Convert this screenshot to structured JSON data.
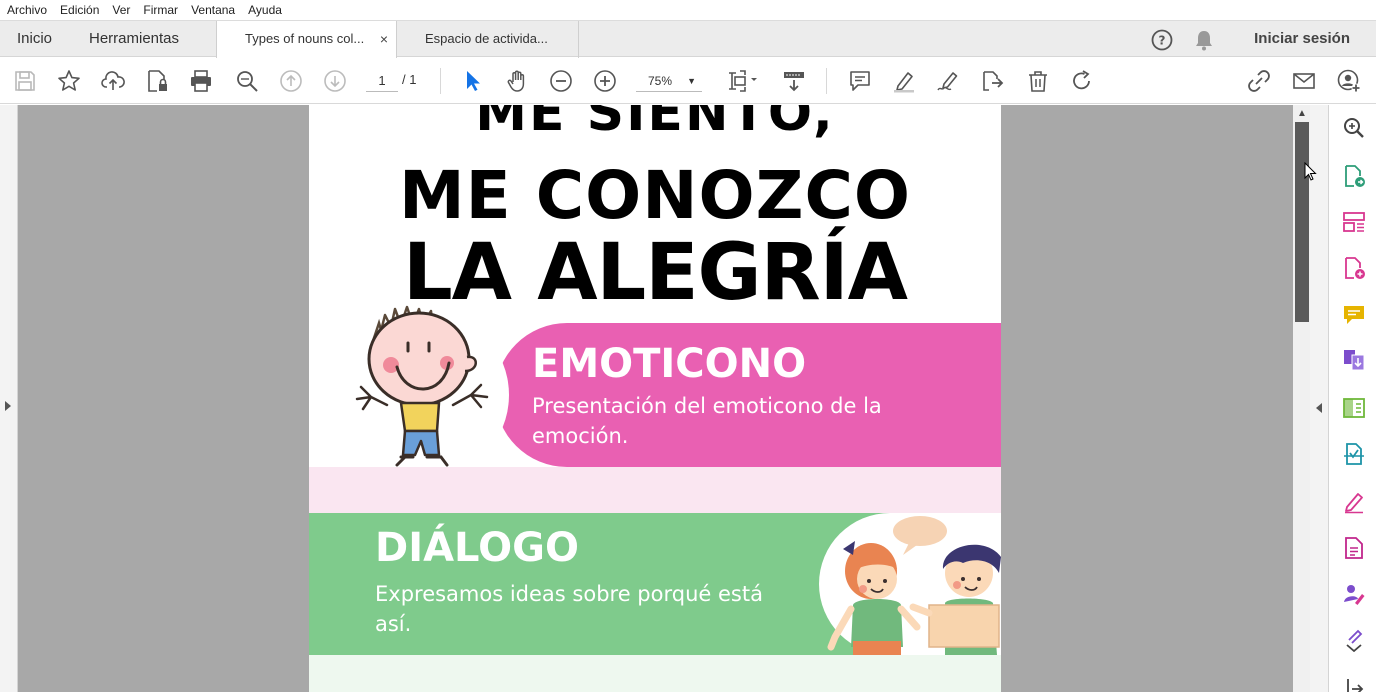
{
  "menu": [
    "Archivo",
    "Edición",
    "Ver",
    "Firmar",
    "Ventana",
    "Ayuda"
  ],
  "tabs": {
    "home": "Inicio",
    "tools": "Herramientas",
    "documents": [
      {
        "label": "Types of nouns col...",
        "close": "×",
        "active": true
      },
      {
        "label": "Espacio de activida...",
        "active": false
      }
    ],
    "signin": "Iniciar sesión"
  },
  "toolbar": {
    "page_current": "1",
    "page_total": "/ 1",
    "zoom": "75%"
  },
  "icons": {
    "toolbar": [
      "save-icon",
      "bookmark-star-icon",
      "upload-cloud-icon",
      "protect-file-icon",
      "print-icon",
      "zoom-search-icon",
      "page-up-icon",
      "page-down-icon",
      "select-arrow-icon",
      "hand-icon",
      "zoom-out-icon",
      "zoom-in-icon",
      "fit-page-icon",
      "scroll-mode-icon",
      "comment-icon",
      "highlight-icon",
      "draw-sign-icon",
      "edit-share-icon",
      "delete-icon",
      "rotate-icon",
      "link-icon",
      "email-icon",
      "add-user-icon"
    ],
    "right_panel": [
      "zoom-panel-icon",
      "export-pdf-icon",
      "organize-pages-icon",
      "create-pdf-icon",
      "comment-panel-icon",
      "combine-icon",
      "edit-pdf-icon",
      "scan-icon",
      "fill-sign-icon",
      "protect-icon",
      "request-sign-icon",
      "more-tools-icon",
      "collapse-icon"
    ]
  },
  "colors": {
    "accent_blue": "#1473e6",
    "pink": "#e960b2",
    "green": "#7fcb8c",
    "icon_green": "#2d9d78",
    "icon_magenta": "#d83790",
    "icon_yellow": "#e6b400",
    "icon_purple": "#7c4dcc"
  },
  "document": {
    "title_line1": "ME SIENTO,",
    "title_line2": "ME CONOZCO",
    "title_line3": "LA ALEGRÍA",
    "emoticono": {
      "title": "EMOTICONO",
      "text": "Presentación del emoticono de la emoción."
    },
    "dialogo": {
      "title": "DIÁLOGO",
      "text": "Expresamos ideas sobre porqué está así."
    }
  }
}
